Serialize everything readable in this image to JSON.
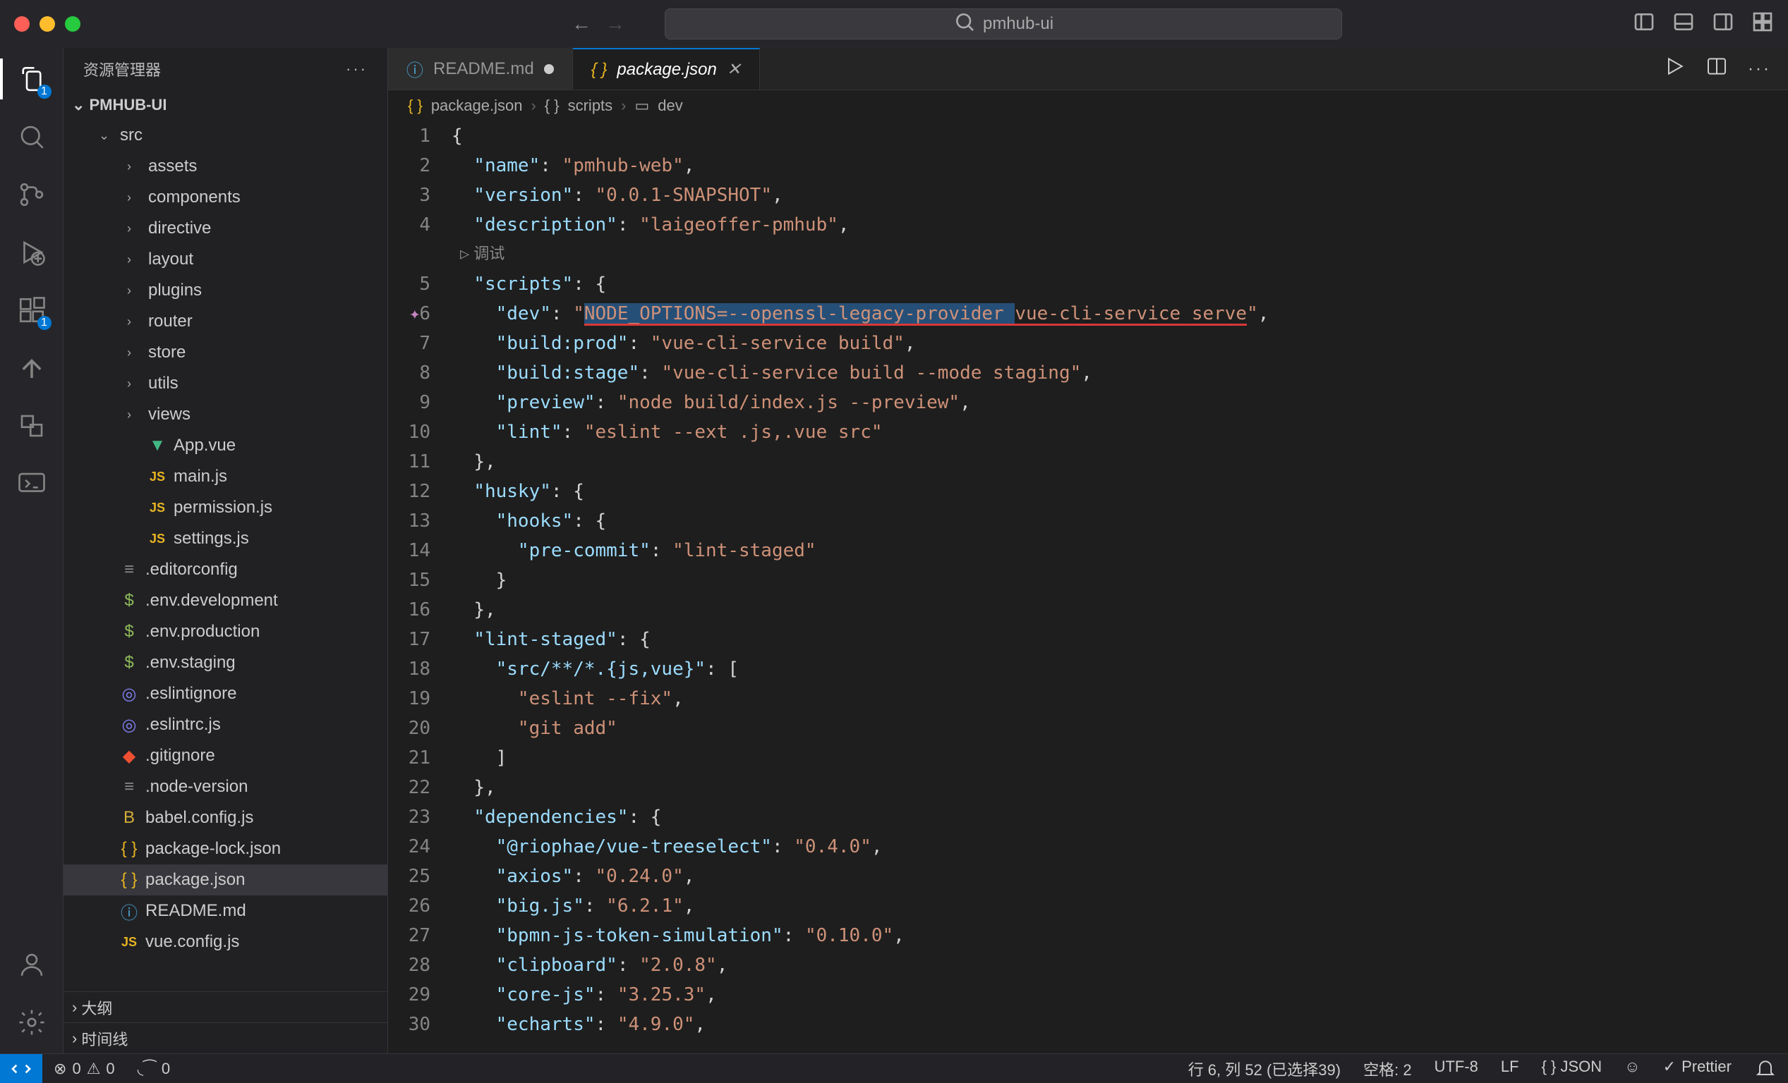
{
  "title_bar": {
    "search": "pmhub-ui"
  },
  "sidebar": {
    "title": "资源管理器",
    "project": "PMHUB-UI",
    "outline": "大纲",
    "timeline": "时间线",
    "tree": [
      {
        "label": "src",
        "type": "folder",
        "depth": 1,
        "expanded": true
      },
      {
        "label": "assets",
        "type": "folder",
        "depth": 2
      },
      {
        "label": "components",
        "type": "folder",
        "depth": 2
      },
      {
        "label": "directive",
        "type": "folder",
        "depth": 2
      },
      {
        "label": "layout",
        "type": "folder",
        "depth": 2
      },
      {
        "label": "plugins",
        "type": "folder",
        "depth": 2
      },
      {
        "label": "router",
        "type": "folder",
        "depth": 2
      },
      {
        "label": "store",
        "type": "folder",
        "depth": 2
      },
      {
        "label": "utils",
        "type": "folder",
        "depth": 2
      },
      {
        "label": "views",
        "type": "folder",
        "depth": 2
      },
      {
        "label": "App.vue",
        "type": "vue",
        "depth": 2
      },
      {
        "label": "main.js",
        "type": "js",
        "depth": 2
      },
      {
        "label": "permission.js",
        "type": "js",
        "depth": 2
      },
      {
        "label": "settings.js",
        "type": "js",
        "depth": 2
      },
      {
        "label": ".editorconfig",
        "type": "gear",
        "depth": 1
      },
      {
        "label": ".env.development",
        "type": "dollar",
        "depth": 1
      },
      {
        "label": ".env.production",
        "type": "dollar",
        "depth": 1
      },
      {
        "label": ".env.staging",
        "type": "dollar",
        "depth": 1
      },
      {
        "label": ".eslintignore",
        "type": "eslint",
        "depth": 1
      },
      {
        "label": ".eslintrc.js",
        "type": "eslint",
        "depth": 1
      },
      {
        "label": ".gitignore",
        "type": "git",
        "depth": 1
      },
      {
        "label": ".node-version",
        "type": "gear",
        "depth": 1
      },
      {
        "label": "babel.config.js",
        "type": "babel",
        "depth": 1
      },
      {
        "label": "package-lock.json",
        "type": "json",
        "depth": 1
      },
      {
        "label": "package.json",
        "type": "json",
        "depth": 1,
        "selected": true
      },
      {
        "label": "README.md",
        "type": "info",
        "depth": 1
      },
      {
        "label": "vue.config.js",
        "type": "js",
        "depth": 1
      }
    ]
  },
  "tabs": [
    {
      "label": "README.md",
      "icon": "info",
      "dirty": true
    },
    {
      "label": "package.json",
      "icon": "json",
      "active": true
    }
  ],
  "breadcrumb": {
    "file": "package.json",
    "path1": "scripts",
    "path2": "dev"
  },
  "debug_hint": "调试",
  "code": {
    "lines": [
      {
        "n": 1,
        "tokens": [
          {
            "t": "{",
            "c": "brace"
          }
        ]
      },
      {
        "n": 2,
        "tokens": [
          {
            "t": "  ",
            "c": ""
          },
          {
            "t": "\"name\"",
            "c": "key"
          },
          {
            "t": ": ",
            "c": "punct"
          },
          {
            "t": "\"pmhub-web\"",
            "c": "str"
          },
          {
            "t": ",",
            "c": "punct"
          }
        ]
      },
      {
        "n": 3,
        "tokens": [
          {
            "t": "  ",
            "c": ""
          },
          {
            "t": "\"version\"",
            "c": "key"
          },
          {
            "t": ": ",
            "c": "punct"
          },
          {
            "t": "\"0.0.1-SNAPSHOT\"",
            "c": "str"
          },
          {
            "t": ",",
            "c": "punct"
          }
        ]
      },
      {
        "n": 4,
        "tokens": [
          {
            "t": "  ",
            "c": ""
          },
          {
            "t": "\"description\"",
            "c": "key"
          },
          {
            "t": ": ",
            "c": "punct"
          },
          {
            "t": "\"laigeoffer-pmhub\"",
            "c": "str"
          },
          {
            "t": ",",
            "c": "punct"
          }
        ],
        "debug_after": true
      },
      {
        "n": 5,
        "tokens": [
          {
            "t": "  ",
            "c": ""
          },
          {
            "t": "\"scripts\"",
            "c": "key"
          },
          {
            "t": ": ",
            "c": "punct"
          },
          {
            "t": "{",
            "c": "brace"
          }
        ]
      },
      {
        "n": 6,
        "sparkle": true,
        "tokens": [
          {
            "t": "    ",
            "c": ""
          },
          {
            "t": "\"dev\"",
            "c": "key"
          },
          {
            "t": ": ",
            "c": "punct"
          },
          {
            "t": "\"",
            "c": "str"
          },
          {
            "t": "NODE_OPTIONS=--openssl-legacy-provider ",
            "c": "str",
            "sel": true,
            "ul": true
          },
          {
            "t": "vue-cli-service serve",
            "c": "str",
            "ul": true
          },
          {
            "t": "\"",
            "c": "str"
          },
          {
            "t": ",",
            "c": "punct"
          }
        ]
      },
      {
        "n": 7,
        "tokens": [
          {
            "t": "    ",
            "c": ""
          },
          {
            "t": "\"build:prod\"",
            "c": "key"
          },
          {
            "t": ": ",
            "c": "punct"
          },
          {
            "t": "\"vue-cli-service build\"",
            "c": "str"
          },
          {
            "t": ",",
            "c": "punct"
          }
        ]
      },
      {
        "n": 8,
        "tokens": [
          {
            "t": "    ",
            "c": ""
          },
          {
            "t": "\"build:stage\"",
            "c": "key"
          },
          {
            "t": ": ",
            "c": "punct"
          },
          {
            "t": "\"vue-cli-service build --mode staging\"",
            "c": "str"
          },
          {
            "t": ",",
            "c": "punct"
          }
        ]
      },
      {
        "n": 9,
        "tokens": [
          {
            "t": "    ",
            "c": ""
          },
          {
            "t": "\"preview\"",
            "c": "key"
          },
          {
            "t": ": ",
            "c": "punct"
          },
          {
            "t": "\"node build/index.js --preview\"",
            "c": "str"
          },
          {
            "t": ",",
            "c": "punct"
          }
        ]
      },
      {
        "n": 10,
        "tokens": [
          {
            "t": "    ",
            "c": ""
          },
          {
            "t": "\"lint\"",
            "c": "key"
          },
          {
            "t": ": ",
            "c": "punct"
          },
          {
            "t": "\"eslint --ext .js,.vue src\"",
            "c": "str"
          }
        ]
      },
      {
        "n": 11,
        "tokens": [
          {
            "t": "  ",
            "c": ""
          },
          {
            "t": "}",
            "c": "brace"
          },
          {
            "t": ",",
            "c": "punct"
          }
        ]
      },
      {
        "n": 12,
        "tokens": [
          {
            "t": "  ",
            "c": ""
          },
          {
            "t": "\"husky\"",
            "c": "key"
          },
          {
            "t": ": ",
            "c": "punct"
          },
          {
            "t": "{",
            "c": "brace"
          }
        ]
      },
      {
        "n": 13,
        "tokens": [
          {
            "t": "    ",
            "c": ""
          },
          {
            "t": "\"hooks\"",
            "c": "key"
          },
          {
            "t": ": ",
            "c": "punct"
          },
          {
            "t": "{",
            "c": "brace"
          }
        ]
      },
      {
        "n": 14,
        "tokens": [
          {
            "t": "      ",
            "c": ""
          },
          {
            "t": "\"pre-commit\"",
            "c": "key"
          },
          {
            "t": ": ",
            "c": "punct"
          },
          {
            "t": "\"lint-staged\"",
            "c": "str"
          }
        ]
      },
      {
        "n": 15,
        "tokens": [
          {
            "t": "    ",
            "c": ""
          },
          {
            "t": "}",
            "c": "brace"
          }
        ]
      },
      {
        "n": 16,
        "tokens": [
          {
            "t": "  ",
            "c": ""
          },
          {
            "t": "}",
            "c": "brace"
          },
          {
            "t": ",",
            "c": "punct"
          }
        ]
      },
      {
        "n": 17,
        "tokens": [
          {
            "t": "  ",
            "c": ""
          },
          {
            "t": "\"lint-staged\"",
            "c": "key"
          },
          {
            "t": ": ",
            "c": "punct"
          },
          {
            "t": "{",
            "c": "brace"
          }
        ]
      },
      {
        "n": 18,
        "tokens": [
          {
            "t": "    ",
            "c": ""
          },
          {
            "t": "\"src/**/*.{js,vue}\"",
            "c": "key"
          },
          {
            "t": ": ",
            "c": "punct"
          },
          {
            "t": "[",
            "c": "brace"
          }
        ]
      },
      {
        "n": 19,
        "tokens": [
          {
            "t": "      ",
            "c": ""
          },
          {
            "t": "\"eslint --fix\"",
            "c": "str"
          },
          {
            "t": ",",
            "c": "punct"
          }
        ]
      },
      {
        "n": 20,
        "tokens": [
          {
            "t": "      ",
            "c": ""
          },
          {
            "t": "\"git add\"",
            "c": "str"
          }
        ]
      },
      {
        "n": 21,
        "tokens": [
          {
            "t": "    ",
            "c": ""
          },
          {
            "t": "]",
            "c": "brace"
          }
        ]
      },
      {
        "n": 22,
        "tokens": [
          {
            "t": "  ",
            "c": ""
          },
          {
            "t": "}",
            "c": "brace"
          },
          {
            "t": ",",
            "c": "punct"
          }
        ]
      },
      {
        "n": 23,
        "tokens": [
          {
            "t": "  ",
            "c": ""
          },
          {
            "t": "\"dependencies\"",
            "c": "key"
          },
          {
            "t": ": ",
            "c": "punct"
          },
          {
            "t": "{",
            "c": "brace"
          }
        ]
      },
      {
        "n": 24,
        "tokens": [
          {
            "t": "    ",
            "c": ""
          },
          {
            "t": "\"@riophae/vue-treeselect\"",
            "c": "key"
          },
          {
            "t": ": ",
            "c": "punct"
          },
          {
            "t": "\"0.4.0\"",
            "c": "str"
          },
          {
            "t": ",",
            "c": "punct"
          }
        ]
      },
      {
        "n": 25,
        "tokens": [
          {
            "t": "    ",
            "c": ""
          },
          {
            "t": "\"axios\"",
            "c": "key"
          },
          {
            "t": ": ",
            "c": "punct"
          },
          {
            "t": "\"0.24.0\"",
            "c": "str"
          },
          {
            "t": ",",
            "c": "punct"
          }
        ]
      },
      {
        "n": 26,
        "tokens": [
          {
            "t": "    ",
            "c": ""
          },
          {
            "t": "\"big.js\"",
            "c": "key"
          },
          {
            "t": ": ",
            "c": "punct"
          },
          {
            "t": "\"6.2.1\"",
            "c": "str"
          },
          {
            "t": ",",
            "c": "punct"
          }
        ]
      },
      {
        "n": 27,
        "tokens": [
          {
            "t": "    ",
            "c": ""
          },
          {
            "t": "\"bpmn-js-token-simulation\"",
            "c": "key"
          },
          {
            "t": ": ",
            "c": "punct"
          },
          {
            "t": "\"0.10.0\"",
            "c": "str"
          },
          {
            "t": ",",
            "c": "punct"
          }
        ]
      },
      {
        "n": 28,
        "tokens": [
          {
            "t": "    ",
            "c": ""
          },
          {
            "t": "\"clipboard\"",
            "c": "key"
          },
          {
            "t": ": ",
            "c": "punct"
          },
          {
            "t": "\"2.0.8\"",
            "c": "str"
          },
          {
            "t": ",",
            "c": "punct"
          }
        ]
      },
      {
        "n": 29,
        "tokens": [
          {
            "t": "    ",
            "c": ""
          },
          {
            "t": "\"core-js\"",
            "c": "key"
          },
          {
            "t": ": ",
            "c": "punct"
          },
          {
            "t": "\"3.25.3\"",
            "c": "str"
          },
          {
            "t": ",",
            "c": "punct"
          }
        ]
      },
      {
        "n": 30,
        "tokens": [
          {
            "t": "    ",
            "c": ""
          },
          {
            "t": "\"echarts\"",
            "c": "key"
          },
          {
            "t": ": ",
            "c": "punct"
          },
          {
            "t": "\"4.9.0\"",
            "c": "str"
          },
          {
            "t": ",",
            "c": "punct"
          }
        ]
      }
    ]
  },
  "status": {
    "errors": "0",
    "warnings": "0",
    "ports": "0",
    "cursor": "行 6, 列 52 (已选择39)",
    "indent": "空格: 2",
    "encoding": "UTF-8",
    "eol": "LF",
    "lang": "{ } JSON",
    "prettier": "Prettier"
  },
  "activity_badges": {
    "explorer": "1",
    "extensions": "1"
  }
}
